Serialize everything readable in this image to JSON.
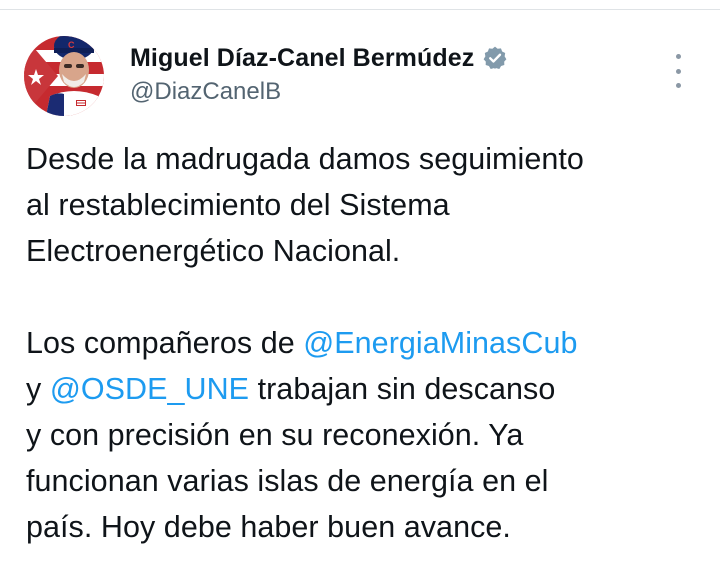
{
  "author": {
    "display_name": "Miguel Díaz-Canel Bermúdez",
    "handle": "@DiazCanelB",
    "verified": true,
    "avatar_icon": "profile-photo"
  },
  "more_options_icon": "vertical-ellipsis-icon",
  "tweet": {
    "paragraph1": {
      "line1": "Desde la madrugada damos seguimiento",
      "line2": "al restablecimiento del Sistema",
      "line3": "Electroenergético Nacional."
    },
    "paragraph2": {
      "line1_text": "Los compañeros de ",
      "line1_mention": "@EnergiaMinasCub",
      "line2_prefix": "y ",
      "line2_mention": "@OSDE_UNE",
      "line2_text": " trabajan sin descanso",
      "line3": "y con precisión en su reconexión. Ya",
      "line4": "funcionan varias islas de energía en el",
      "line5": "país. Hoy debe haber buen avance."
    }
  },
  "colors": {
    "text": "#0f1419",
    "secondary": "#536471",
    "mention": "#1d9bf0",
    "verified_badge": "#829aab"
  }
}
